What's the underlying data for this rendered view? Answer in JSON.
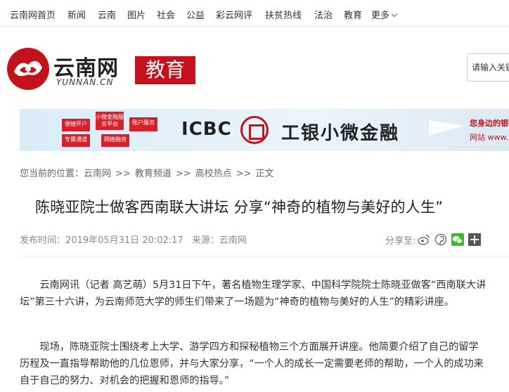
{
  "topnav": {
    "items": [
      "云南网首页",
      "新闻",
      "云南",
      "图片",
      "社会",
      "公益",
      "彩云网评",
      "扶贫热线",
      "法治",
      "教育"
    ],
    "more_label": "更多"
  },
  "logo": {
    "name": "云南网",
    "sub": "YUNNAN.CN",
    "channel": "教育"
  },
  "search": {
    "placeholder": "请输入关键"
  },
  "banner": {
    "brand": "ICBC",
    "slogan": "工银小微金融",
    "tagline": "您身边的银行 可信",
    "site": "网站 www.icbc.co",
    "blocks": [
      "便捷开户",
      "小微金融服务平台",
      "账户服务",
      "专属通道",
      "网络融资"
    ]
  },
  "breadcrumb": {
    "prefix": "您当前的位置：",
    "items": [
      "云南网",
      "教育频道",
      "高校热点",
      "正文"
    ],
    "separator": ">>"
  },
  "article": {
    "title": "陈晓亚院士做客西南联大讲坛 分享“神奇的植物与美好的人生”",
    "publish_label": "发布时间：",
    "publish_time": "2019年05月31日 20:02:17",
    "source_label": "来源：",
    "source": "云南网",
    "share_label": "分享至:",
    "paragraphs": [
      "云南网讯（记者 高艺萌）5月31日下午，著名植物生理学家、中国科学院院士陈晓亚做客“西南联大讲坛”第三十六讲，为云南师范大学的师生们带来了一场题为“神奇的植物与美好的人生”的精彩讲座。",
      "现场，陈晓亚院士围绕考上大学、游学四方和探秘植物三个方面展开讲座。他简要介绍了自己的留学历程及一直指导帮助他的几位恩师，并与大家分享，“一个人的成长一定需要老师的帮助，一个人的成功来自于自己的努力、对机会的把握和恩师的指导。”"
    ]
  },
  "colors": {
    "brand_red": "#c4121d",
    "wechat_green": "#3fb834"
  },
  "share_icons": [
    "weibo-icon",
    "pinterest-icon",
    "wechat-icon",
    "plus-icon"
  ]
}
